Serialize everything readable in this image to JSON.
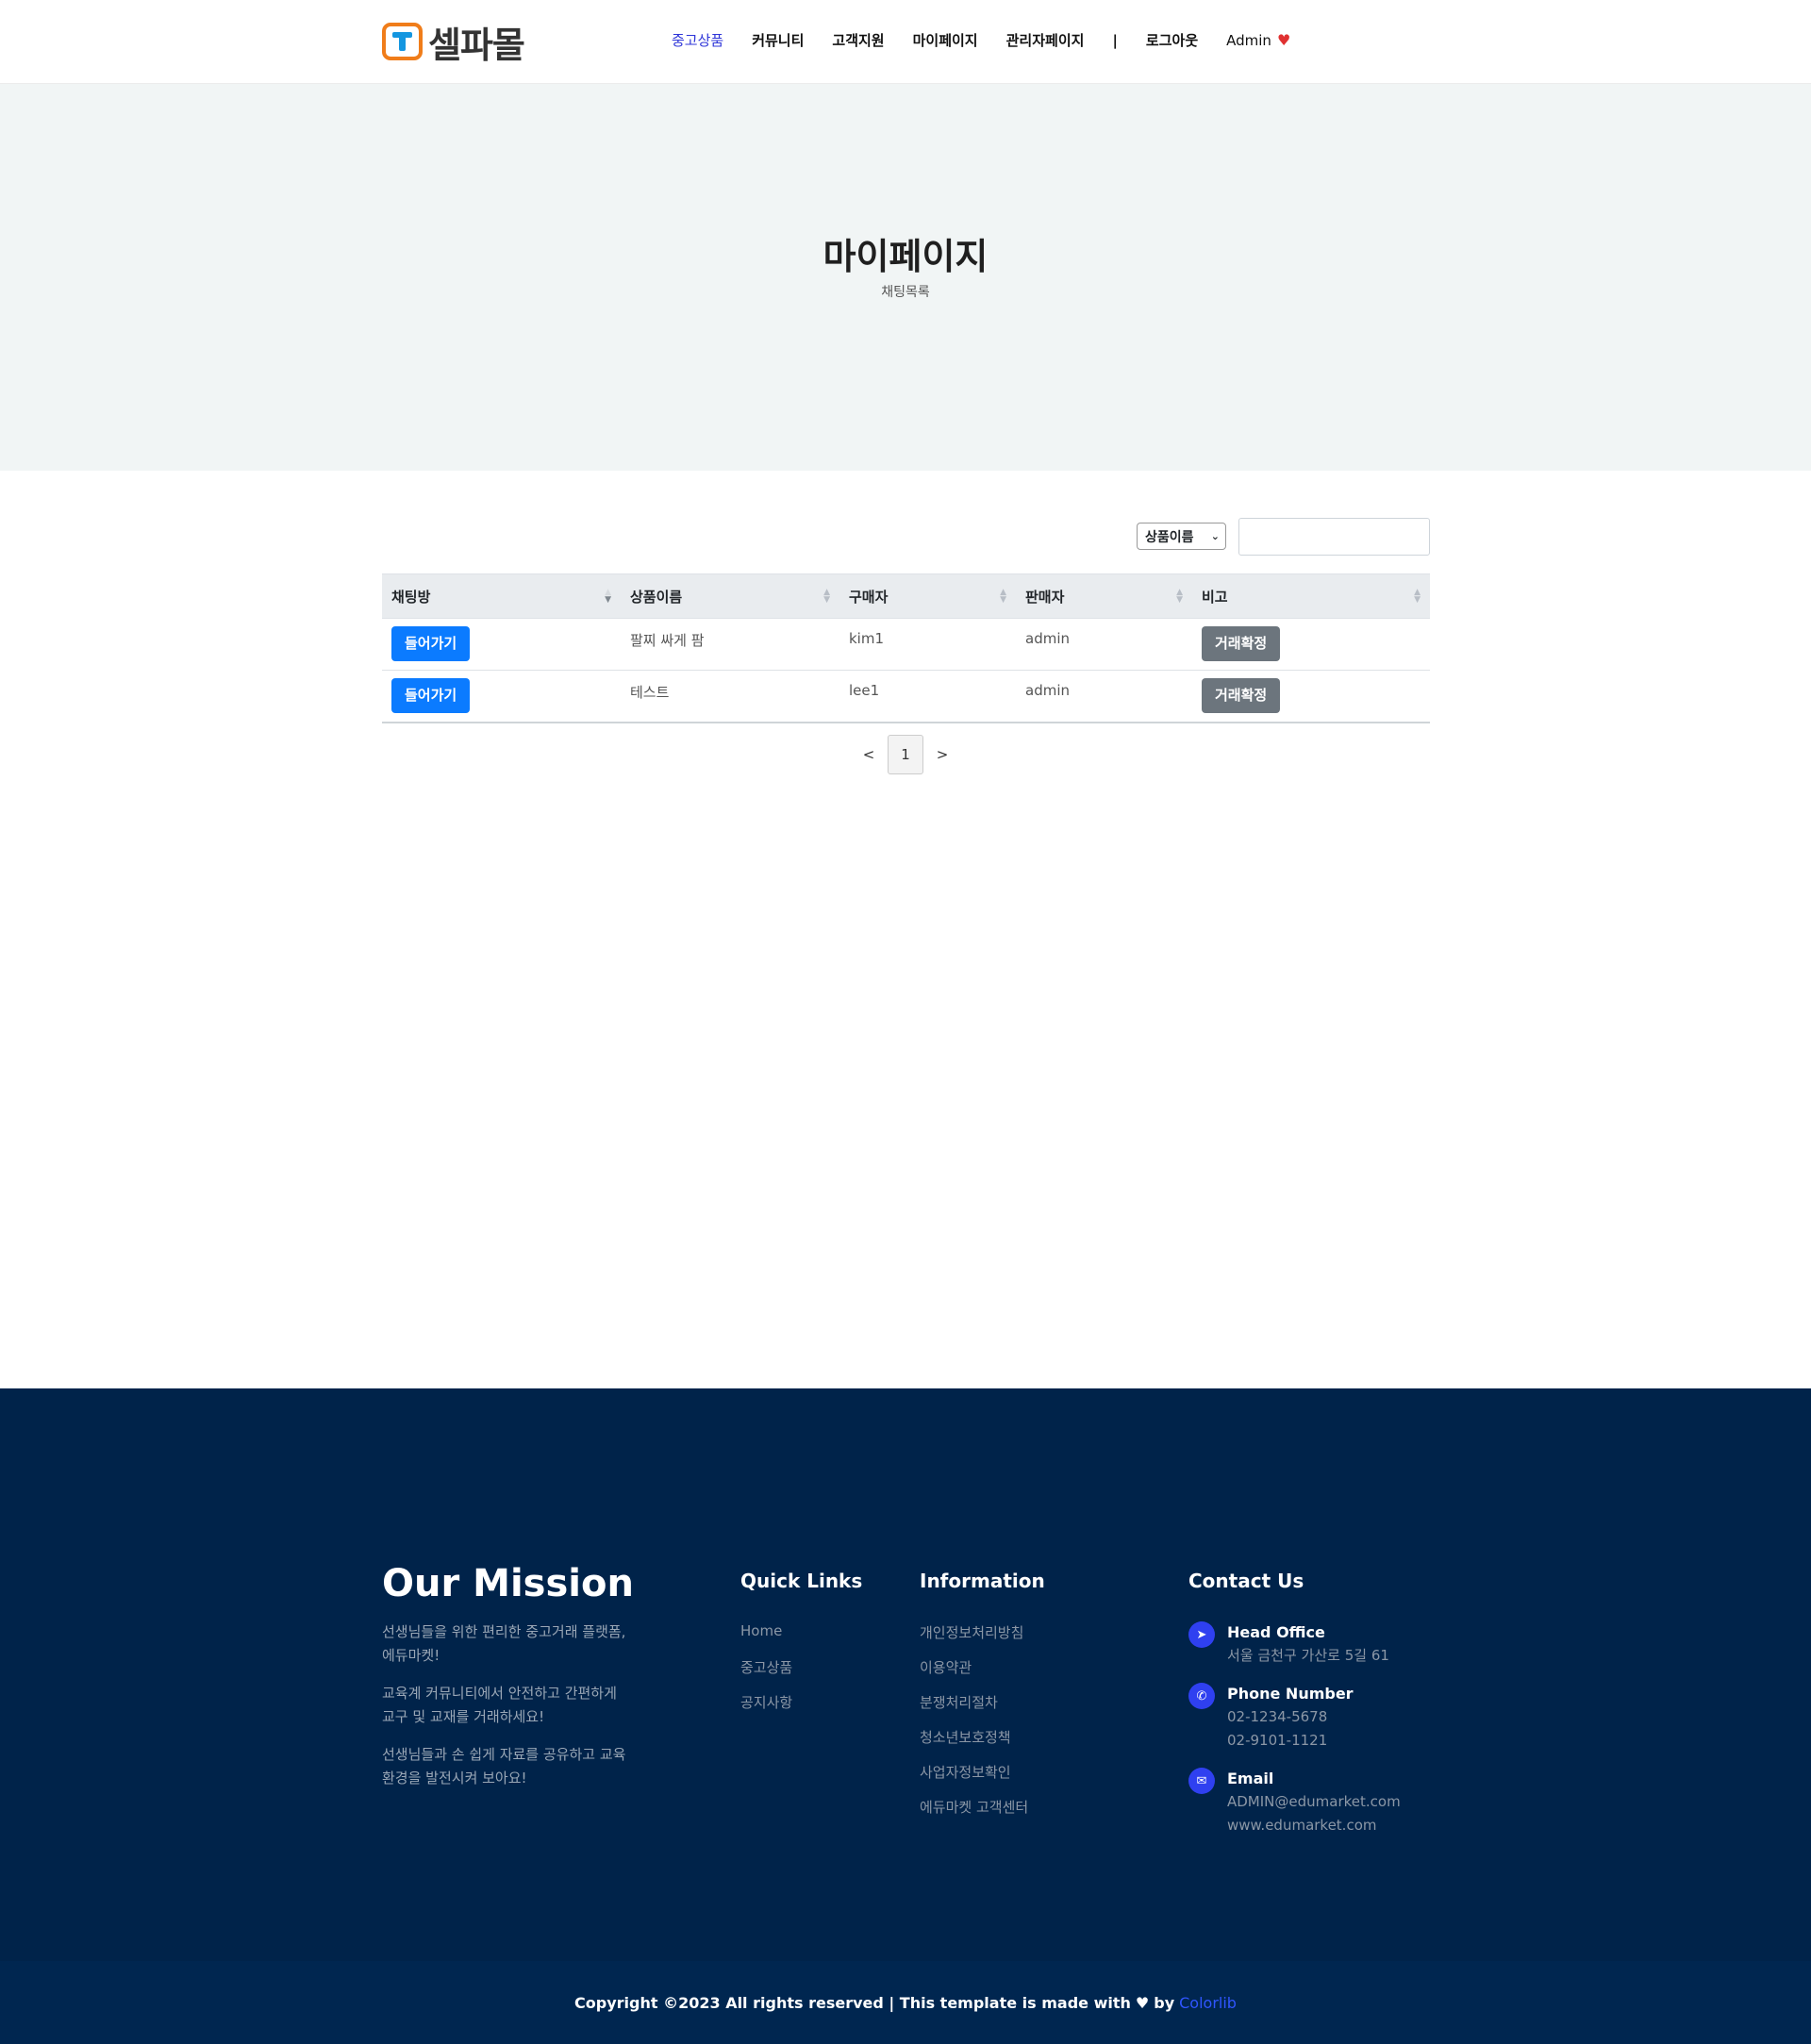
{
  "header": {
    "logo_text": "셀파몰",
    "nav": [
      "중고상품",
      "커뮤니티",
      "고객지원",
      "마이페이지",
      "관리자페이지"
    ],
    "separator": "|",
    "logout": "로그아웃",
    "user": "Admin"
  },
  "hero": {
    "title": "마이페이지",
    "subtitle": "채팅목록"
  },
  "filter": {
    "select_value": "상품이름",
    "search_value": ""
  },
  "table": {
    "headers": [
      "채팅방",
      "상품이름",
      "구매자",
      "판매자",
      "비고"
    ],
    "rows": [
      {
        "enter": "들어가기",
        "product": "팔찌 싸게 팜",
        "buyer": "kim1",
        "seller": "admin",
        "action": "거래확정"
      },
      {
        "enter": "들어가기",
        "product": "테스트",
        "buyer": "lee1",
        "seller": "admin",
        "action": "거래확정"
      }
    ]
  },
  "pagination": {
    "prev": "<",
    "current": "1",
    "next": ">"
  },
  "footer": {
    "mission_title": "Our Mission",
    "mission_paragraphs": [
      "선생님들을 위한 편리한 중고거래 플랫폼, 에듀마켓!",
      "교육계 커뮤니티에서 안전하고 간편하게 교구 및 교재를 거래하세요!",
      "선생님들과 손 쉽게 자료를 공유하고 교육 환경을 발전시켜 보아요!"
    ],
    "quick_links_title": "Quick Links",
    "quick_links": [
      "Home",
      "중고상품",
      "공지사항"
    ],
    "info_title": "Information",
    "info_links": [
      "개인정보처리방침",
      "이용약관",
      "분쟁처리절차",
      "청소년보호정책",
      "사업자정보확인",
      "에듀마켓 고객센터"
    ],
    "contact_title": "Contact Us",
    "contact": {
      "office_title": "Head Office",
      "office_address": "서울 금천구 가산로 5길 61",
      "phone_title": "Phone Number",
      "phone_1": "02-1234-5678",
      "phone_2": "02-9101-1121",
      "email_title": "Email",
      "email": "ADMIN@edumarket.com",
      "website": "www.edumarket.com"
    },
    "copyright_text": "Copyright ©2023 All rights reserved | This template is made with",
    "copyright_by": "by",
    "copyright_brand": "Colorlib"
  },
  "colors": {
    "primary_button": "#0b7bff",
    "secondary_button": "#6c757d",
    "nav_active": "#2f36d8",
    "footer_bg": "#00234a",
    "hero_bg": "#f1f5f5"
  },
  "icons": [
    "heart-icon",
    "location-arrow-icon",
    "phone-icon",
    "envelope-icon",
    "chevron-down-icon",
    "sort-icon"
  ]
}
